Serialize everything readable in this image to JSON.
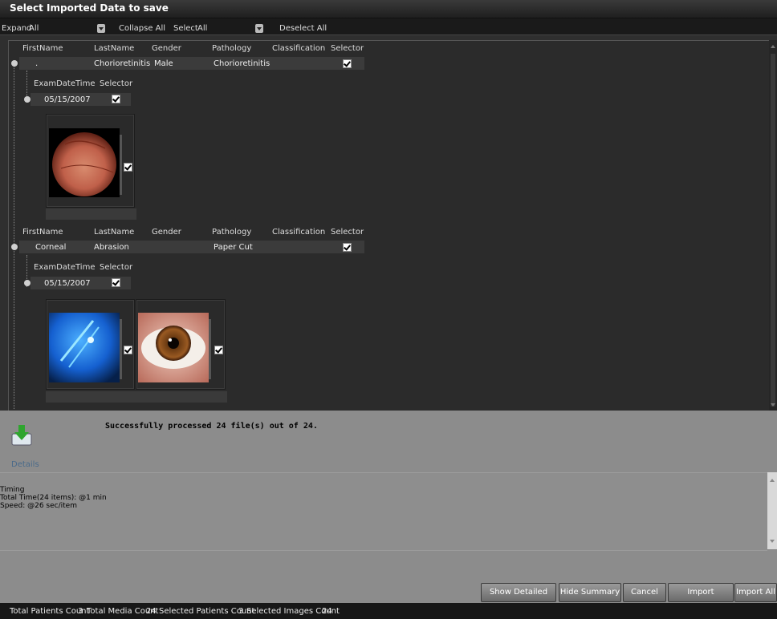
{
  "title": "Select Imported Data to save",
  "toolbar": {
    "expand_label": "Expand",
    "expand_value": "All",
    "collapse_all": "Collapse All",
    "select_label": "Select",
    "select_value": "All",
    "deselect_all": "Deselect All"
  },
  "columns": [
    "FirstName",
    "LastName",
    "Gender",
    "Pathology",
    "Classification",
    "Selector"
  ],
  "exam_columns": [
    "ExamDateTime",
    "Selector"
  ],
  "patients": [
    {
      "first": ".",
      "last": "Chorioretinitis",
      "gender": "Male",
      "pathology": "Chorioretinitis",
      "classification": "",
      "exam_date": "05/15/2007"
    },
    {
      "first": "Corneal",
      "last": "Abrasion",
      "gender": "",
      "pathology": "Paper Cut",
      "classification": "",
      "exam_date": "05/15/2007"
    }
  ],
  "summary": {
    "message": "Successfully processed 24 file(s) out of 24.",
    "details_label": "Details",
    "log_lines": [
      "Timing",
      "Total Time(24 items): @1 min",
      "Speed: @26 sec/item"
    ]
  },
  "buttons": {
    "show_log": "Show Detailed Log",
    "hide_summary": "Hide Summary",
    "cancel": "Cancel",
    "import_selection": "Import Selection",
    "import_all": "Import All"
  },
  "status": {
    "total_patients_label": "Total Patients Count",
    "total_patients": "3",
    "total_media_label": "Total Media Count",
    "total_media": "24",
    "selected_patients_label": "Selected Patients Count",
    "selected_patients": "3",
    "selected_images_label": "Selected Images Count",
    "selected_images": "24"
  },
  "colors": {
    "background": "#2f2f2f",
    "panel": "#8c8c8c",
    "status_bar": "#171717",
    "details_link": "#4a6a8a"
  }
}
